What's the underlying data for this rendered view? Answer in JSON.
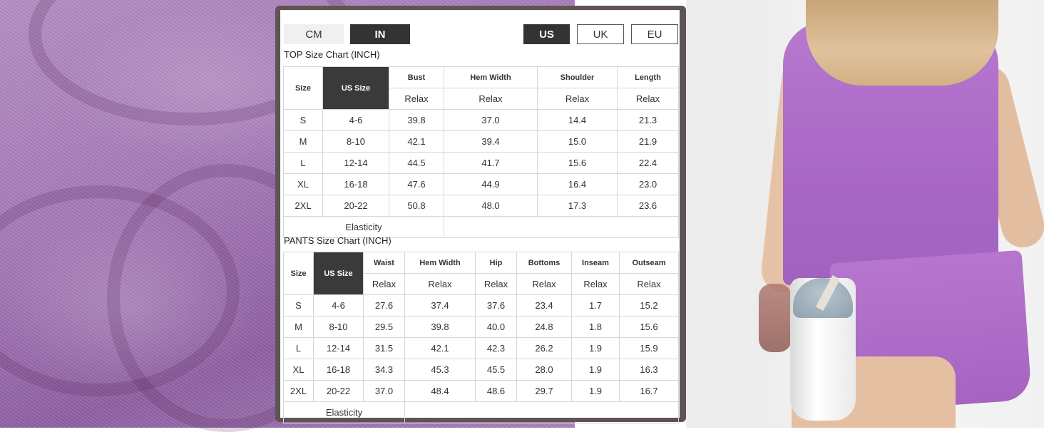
{
  "units": {
    "cm": "CM",
    "in": "IN"
  },
  "regions": {
    "us": "US",
    "uk": "UK",
    "eu": "EU"
  },
  "top_chart": {
    "title": "TOP Size Chart (INCH)",
    "headers": {
      "size": "Size",
      "us_size": "US Size",
      "bust": "Bust",
      "hem_width": "Hem Width",
      "shoulder": "Shoulder",
      "length": "Length"
    },
    "fit": [
      "Relax",
      "Relax",
      "Relax",
      "Relax"
    ],
    "rows": [
      [
        "S",
        "4-6",
        "39.8",
        "37.0",
        "14.4",
        "21.3"
      ],
      [
        "M",
        "8-10",
        "42.1",
        "39.4",
        "15.0",
        "21.9"
      ],
      [
        "L",
        "12-14",
        "44.5",
        "41.7",
        "15.6",
        "22.4"
      ],
      [
        "XL",
        "16-18",
        "47.6",
        "44.9",
        "16.4",
        "23.0"
      ],
      [
        "2XL",
        "20-22",
        "50.8",
        "48.0",
        "17.3",
        "23.6"
      ]
    ],
    "elasticity": "Elasticity"
  },
  "pants_chart": {
    "title": "PANTS Size Chart (INCH)",
    "headers": {
      "size": "Size",
      "us_size": "US Size",
      "waist": "Waist",
      "hem_width": "Hem Width",
      "hip": "Hip",
      "bottoms": "Bottoms",
      "inseam": "Inseam",
      "outseam": "Outseam"
    },
    "fit": [
      "Relax",
      "Relax",
      "Relax",
      "Relax",
      "Relax",
      "Relax"
    ],
    "rows": [
      [
        "S",
        "4-6",
        "27.6",
        "37.4",
        "37.6",
        "23.4",
        "1.7",
        "15.2"
      ],
      [
        "M",
        "8-10",
        "29.5",
        "39.8",
        "40.0",
        "24.8",
        "1.8",
        "15.6"
      ],
      [
        "L",
        "12-14",
        "31.5",
        "42.1",
        "42.3",
        "26.2",
        "1.9",
        "15.9"
      ],
      [
        "XL",
        "16-18",
        "34.3",
        "45.3",
        "45.5",
        "28.0",
        "1.9",
        "16.3"
      ],
      [
        "2XL",
        "20-22",
        "37.0",
        "48.4",
        "48.6",
        "29.7",
        "1.9",
        "16.7"
      ]
    ],
    "elasticity": "Elasticity"
  },
  "colors": {
    "fabric": "#a679b8",
    "card_frame": "#5e5454",
    "active": "#333333"
  }
}
